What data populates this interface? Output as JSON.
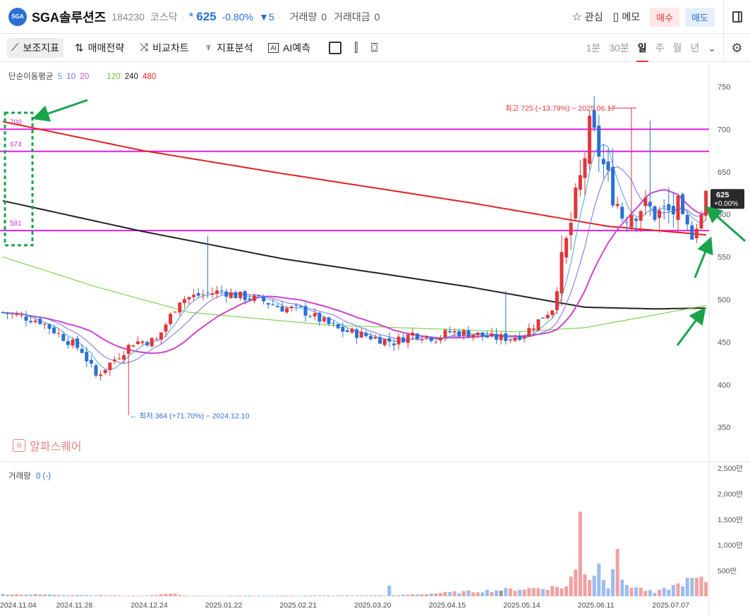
{
  "header": {
    "logo_text": "SGA",
    "stock_name": "SGA솔루션즈",
    "stock_code": "184230",
    "market": "코스닥",
    "price_marker": "*",
    "price": "625",
    "change_pct": "-0.80%",
    "change": "▼5",
    "volume_label": "거래량",
    "volume": "0",
    "amount_label": "거래대금",
    "amount": "0",
    "watch_label": "관심",
    "memo_label": "메모",
    "buy_label": "매수",
    "sell_label": "매도"
  },
  "toolbar": {
    "indicator_label": "보조지표",
    "strategy_label": "매매전략",
    "compare_label": "비교차트",
    "analysis_label": "지표분석",
    "ai_label": "AI예측",
    "periods": [
      "1분",
      "30분",
      "일",
      "주",
      "월",
      "년"
    ],
    "selected_period": "일"
  },
  "ma_legend": {
    "title": "단순이동평균",
    "items": [
      {
        "label": "5",
        "color": "#4aa3df"
      },
      {
        "label": "10",
        "color": "#7b68ee"
      },
      {
        "label": "20",
        "color": "#cc44cc"
      },
      {
        "label": "120",
        "color": "#66cc33"
      },
      {
        "label": "240",
        "color": "#222222"
      },
      {
        "label": "480",
        "color": "#e02020"
      }
    ]
  },
  "watermark": {
    "icon": "α",
    "text": "알파스퀘어"
  },
  "volume_legend": {
    "label": "거래량",
    "value": "0 (-)"
  },
  "colors": {
    "up": "#e0373a",
    "down": "#2b6fd6",
    "hline": "#e020e0",
    "annotation": "#19a34a"
  },
  "chart_data": {
    "type": "candlestick",
    "price_axis": {
      "ticks": [
        350,
        400,
        450,
        500,
        550,
        600,
        650,
        700,
        750
      ]
    },
    "current_price": {
      "label": "625",
      "change": "+0.00%"
    },
    "horizontal_lines": [
      {
        "label": "700",
        "value": 700
      },
      {
        "label": "674",
        "value": 674
      },
      {
        "label": "581",
        "value": 581
      }
    ],
    "annotations": {
      "high": "최고 725 (−13.79%) − 2025.06.17",
      "low": "← 최저 364 (+71.70%) − 2024.12.10"
    },
    "x_ticks": [
      "2024.11.04",
      "2024.11.28",
      "2024.12.24",
      "2025.01.22",
      "2025.02.21",
      "2025.03.20",
      "2025.04.15",
      "2025.05.14",
      "2025.06.11",
      "2025.07.07"
    ],
    "volume_axis": {
      "ticks": [
        "2,500만",
        "2,000만",
        "1,500만",
        "1,000만",
        "500만"
      ],
      "values": [
        2500,
        2000,
        1500,
        1000,
        500
      ]
    },
    "price_path": [
      [
        0,
        485
      ],
      [
        8,
        475
      ],
      [
        17,
        440
      ],
      [
        20,
        410
      ],
      [
        23,
        425
      ],
      [
        28,
        450
      ],
      [
        33,
        452
      ],
      [
        38,
        500
      ],
      [
        42,
        505
      ],
      [
        47,
        510
      ],
      [
        50,
        505
      ],
      [
        55,
        500
      ],
      [
        60,
        490
      ],
      [
        64,
        488
      ],
      [
        72,
        465
      ],
      [
        80,
        455
      ],
      [
        84,
        450
      ],
      [
        88,
        460
      ],
      [
        93,
        455
      ],
      [
        96,
        462
      ],
      [
        101,
        460
      ],
      [
        105,
        455
      ],
      [
        109,
        455
      ],
      [
        112,
        460
      ],
      [
        115,
        475
      ],
      [
        118,
        490
      ],
      [
        120,
        540
      ],
      [
        122,
        590
      ],
      [
        124,
        640
      ],
      [
        126,
        700
      ],
      [
        127,
        690
      ],
      [
        130,
        640
      ],
      [
        133,
        600
      ],
      [
        137,
        610
      ],
      [
        141,
        600
      ],
      [
        145,
        605
      ],
      [
        148,
        575
      ],
      [
        150,
        600
      ],
      [
        151,
        625
      ]
    ],
    "volume_path": [
      [
        0,
        50
      ],
      [
        30,
        10
      ],
      [
        36,
        60
      ],
      [
        37,
        50
      ],
      [
        40,
        10
      ],
      [
        82,
        20
      ],
      [
        83,
        210
      ],
      [
        84,
        20
      ],
      [
        121,
        220
      ],
      [
        123,
        600
      ],
      [
        124,
        2300
      ],
      [
        125,
        590
      ],
      [
        126,
        400
      ],
      [
        128,
        700
      ],
      [
        130,
        250
      ],
      [
        132,
        1250
      ],
      [
        133,
        300
      ],
      [
        140,
        80
      ],
      [
        148,
        380
      ],
      [
        150,
        360
      ]
    ],
    "ma_lines": [
      {
        "name": "480",
        "color": "#e02020",
        "points": [
          [
            0,
            709
          ],
          [
            30,
            675
          ],
          [
            60,
            648
          ],
          [
            100,
            614
          ],
          [
            130,
            586
          ],
          [
            151,
            576
          ]
        ]
      },
      {
        "name": "240",
        "color": "#222222",
        "points": [
          [
            0,
            616
          ],
          [
            30,
            580
          ],
          [
            60,
            548
          ],
          [
            100,
            515
          ],
          [
            125,
            491
          ],
          [
            140,
            489
          ],
          [
            151,
            490
          ]
        ]
      },
      {
        "name": "120",
        "color": "#66cc33",
        "points": [
          [
            0,
            550
          ],
          [
            20,
            515
          ],
          [
            40,
            485
          ],
          [
            70,
            470
          ],
          [
            110,
            462
          ],
          [
            125,
            467
          ],
          [
            140,
            482
          ],
          [
            151,
            493
          ]
        ]
      }
    ]
  }
}
